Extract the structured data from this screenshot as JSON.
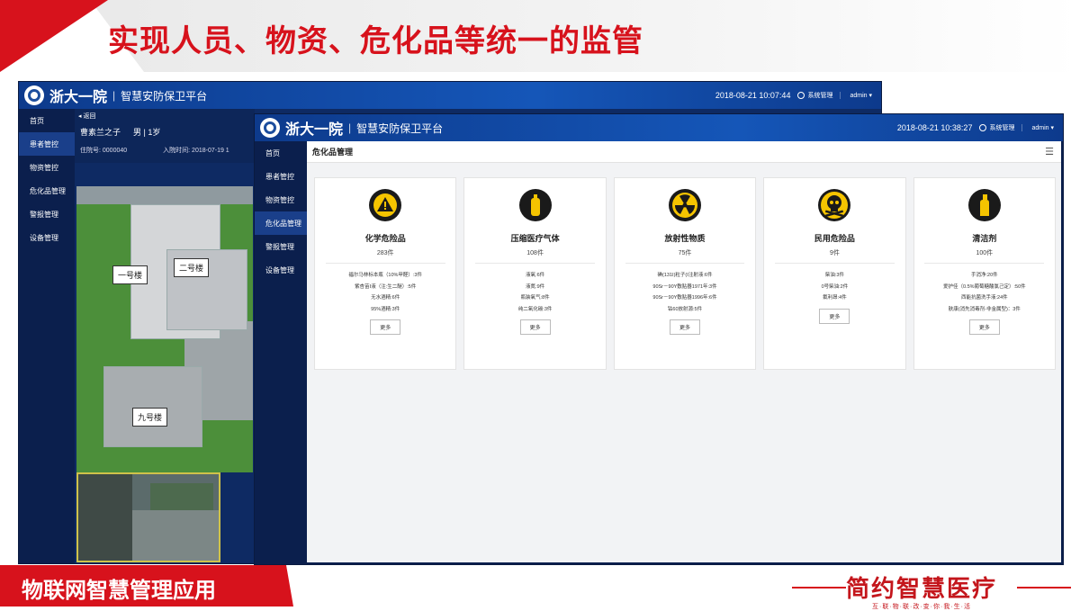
{
  "slide": {
    "title": "实现人员、物资、危化品等统一的监管",
    "footer": "物联网智慧管理应用",
    "logo_main": "简约智慧医疗",
    "logo_sub": "互·联·物·联·改·变·你·我·生·活",
    "brand_red": "#d7121c"
  },
  "back": {
    "brand": "浙大一院",
    "sep": "|",
    "platform": "智慧安防保卫平台",
    "datetime": "2018-08-21 10:07:44",
    "sys_label": "系统管理",
    "user": "admin",
    "sidebar": [
      "首页",
      "患者管控",
      "物资管控",
      "危化品管理",
      "警报管理",
      "设备管理"
    ],
    "back_label": "返回",
    "patient": {
      "name": "曹素兰之子",
      "gender_age": "男 | 1岁",
      "id_label": "住院号: 0000040",
      "admit_label": "入院时间: 2018-07-19 1"
    },
    "buildings": [
      "一号楼",
      "二号楼",
      "九号楼"
    ]
  },
  "front": {
    "brand": "浙大一院",
    "sep": "|",
    "platform": "智慧安防保卫平台",
    "datetime": "2018-08-21 10:38:27",
    "sys_label": "系统管理",
    "user": "admin",
    "sidebar": [
      "首页",
      "患者管控",
      "物资管控",
      "危化品管理",
      "警报管理",
      "设备管理"
    ],
    "panel_title": "危化品管理",
    "more_label": "更多",
    "cards": [
      {
        "title": "化学危险品",
        "count": "283件",
        "icon": "warning-icon",
        "items": [
          "福尔马林标本瓶（10%甲醛）:3件",
          "紫杏苗Ⅰ液（注:生二醚）:5件",
          "无水酒精:6件",
          "95%酒精:3件"
        ]
      },
      {
        "title": "压缩医疗气体",
        "count": "108件",
        "icon": "gas-cylinder-icon",
        "items": [
          "液氧:6件",
          "液氮:9件",
          "瓶装氧气:8件",
          "纯二氧化碳:3件"
        ]
      },
      {
        "title": "放射性物质",
        "count": "75件",
        "icon": "radiation-icon",
        "items": [
          "碘(131I)粒子(Ⅰ注射液:6件",
          "90Sr－90Y敷贴器1971年:3件",
          "90Sr－90Y敷贴器1996年:6件",
          "钴60放射源:5件"
        ]
      },
      {
        "title": "民用危险品",
        "count": "9件",
        "icon": "skull-icon",
        "items": [
          "柴油:3件",
          "0号柴油:2件",
          "氟利昂:4件"
        ]
      },
      {
        "title": "清洁剂",
        "count": "100件",
        "icon": "spray-bottle-icon",
        "items": [
          "手消净:20件",
          "爱护佳（0.5%葡萄糖酸氯己定）:50件",
          "西能抗菌洗手液:24件",
          "肤康(消先消毒剂-非金属型)：3件"
        ]
      }
    ]
  }
}
